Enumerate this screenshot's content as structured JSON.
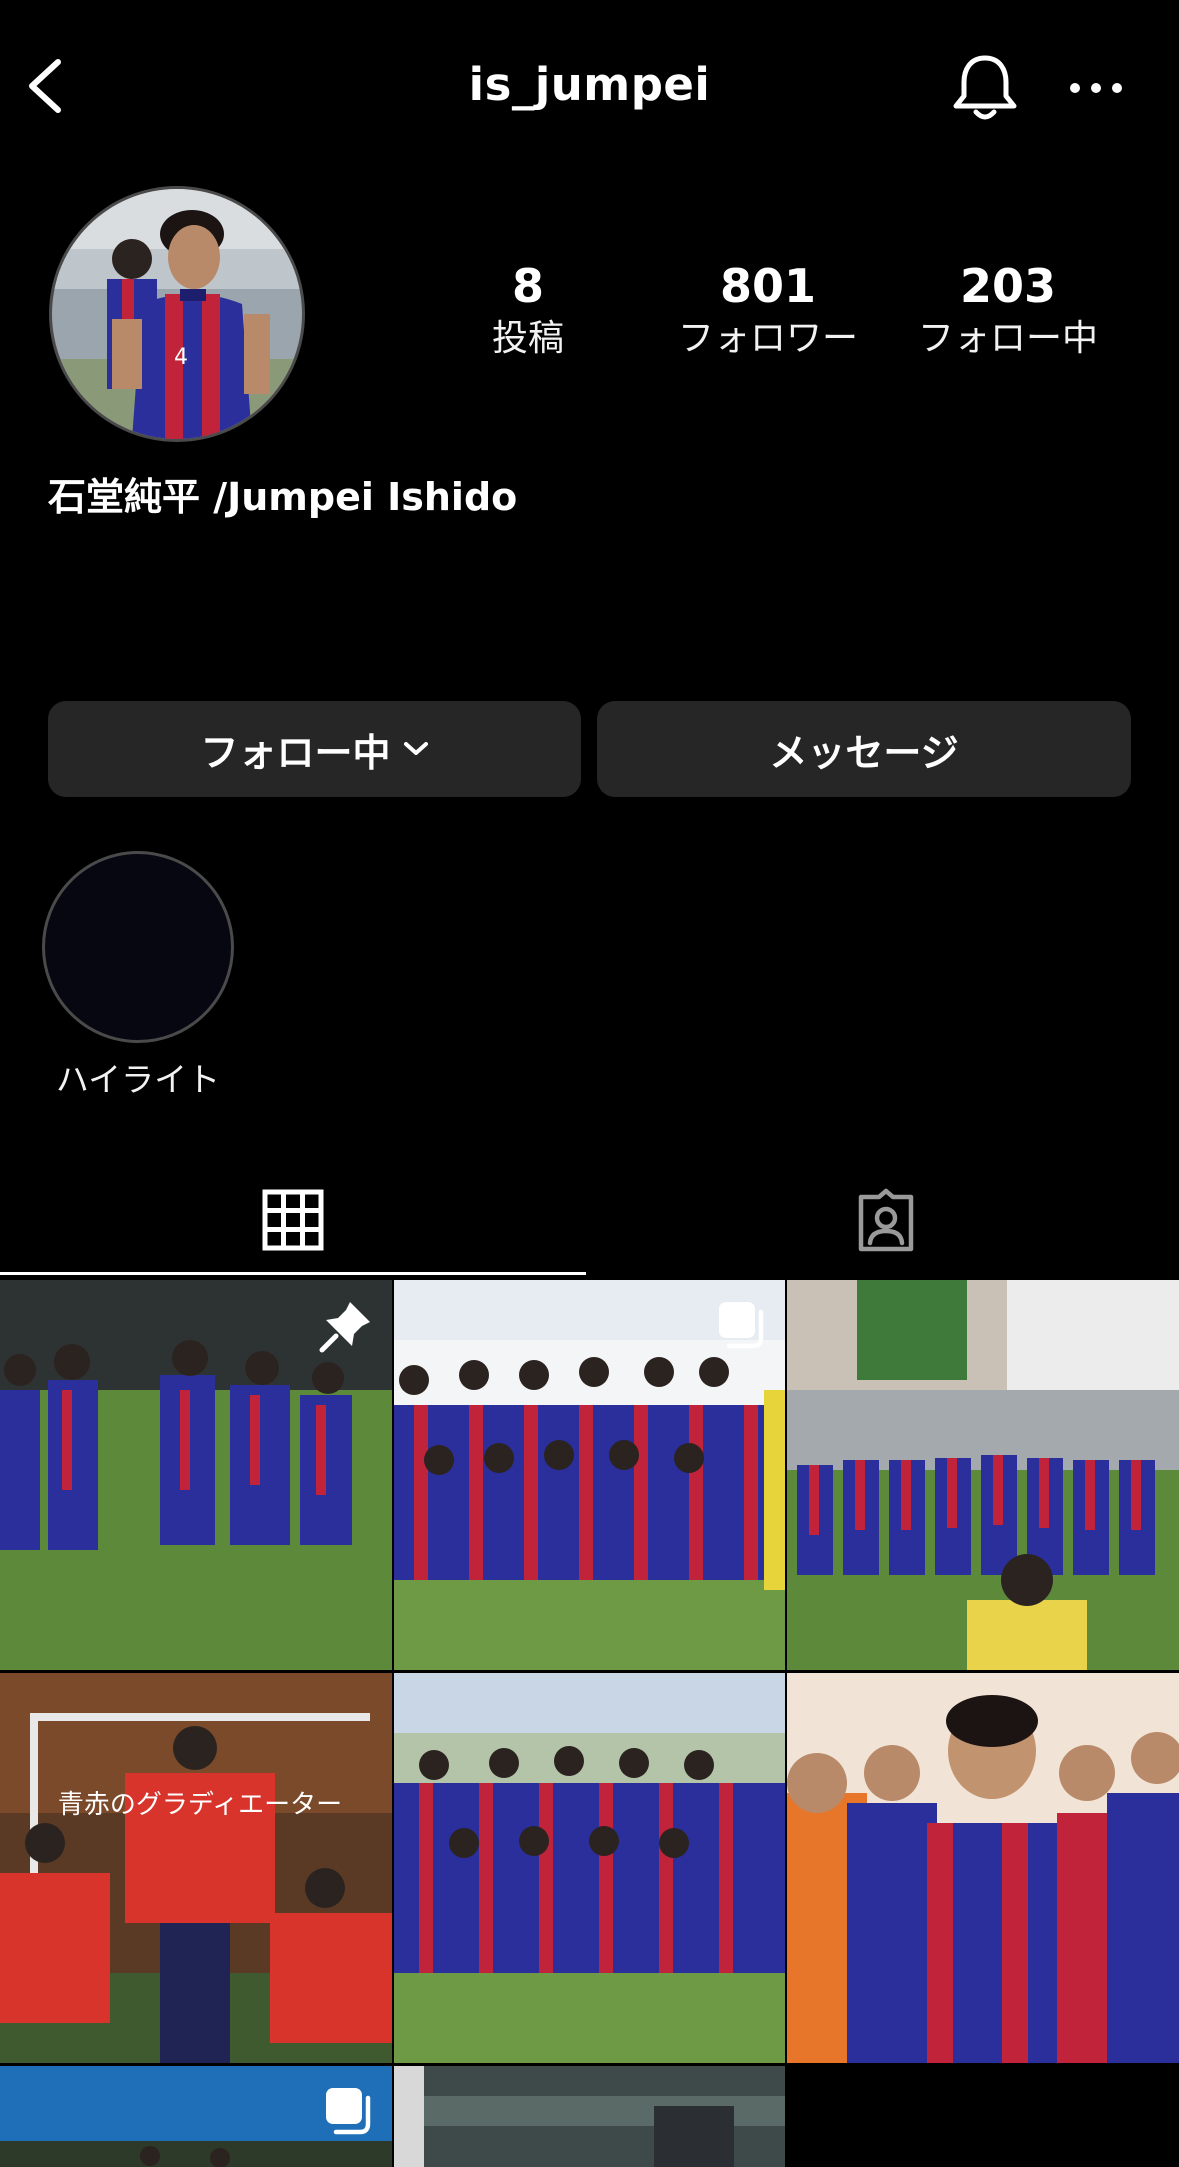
{
  "header": {
    "username": "is_jumpei",
    "back_icon": "chevron-left-icon",
    "bell_icon": "bell-icon",
    "more_icon": "more-horizontal-icon"
  },
  "profile": {
    "stats": {
      "posts": {
        "value": "8",
        "label": "投稿"
      },
      "followers": {
        "value": "801",
        "label": "フォロワー"
      },
      "following": {
        "value": "203",
        "label": "フォロー中"
      }
    },
    "display_name": "石堂純平 /Jumpei Ishido"
  },
  "actions": {
    "follow_label": "フォロー中",
    "message_label": "メッセージ"
  },
  "highlights": [
    {
      "label": "ハイライト"
    }
  ],
  "tabs": [
    {
      "name": "posts-grid",
      "icon": "grid-icon",
      "active": true
    },
    {
      "name": "tagged",
      "icon": "tagged-person-icon",
      "active": false
    }
  ],
  "posts": [
    {
      "index": 1,
      "type": "image",
      "pinned": true,
      "banner_text": ""
    },
    {
      "index": 2,
      "type": "carousel",
      "pinned": false,
      "banner_text": ""
    },
    {
      "index": 3,
      "type": "image",
      "pinned": false,
      "banner_text": ""
    },
    {
      "index": 4,
      "type": "image",
      "pinned": false,
      "banner_text": "青赤のグラディエーター"
    },
    {
      "index": 5,
      "type": "image",
      "pinned": false,
      "banner_text": ""
    },
    {
      "index": 6,
      "type": "image",
      "pinned": false,
      "banner_text": ""
    },
    {
      "index": 7,
      "type": "carousel",
      "pinned": false,
      "banner_text": ""
    },
    {
      "index": 8,
      "type": "image",
      "pinned": false,
      "banner_text": ""
    }
  ],
  "colors": {
    "background": "#000000",
    "button_bg": "#262626",
    "kit_blue": "#2b2f9c",
    "kit_red": "#c0233a",
    "pitch_green": "#5f8c3a"
  }
}
